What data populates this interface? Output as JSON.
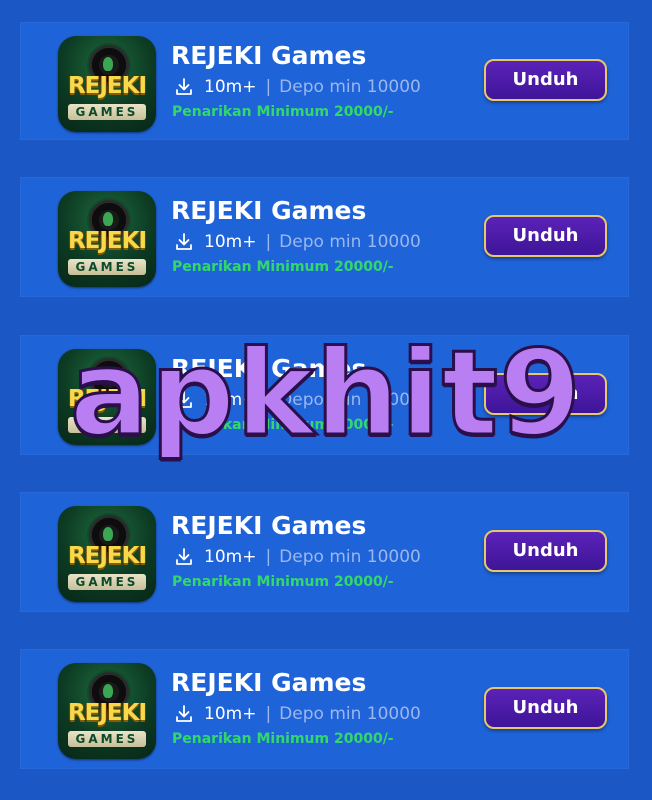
{
  "colors": {
    "background": "#1b58c6",
    "card": "#1f63d9",
    "button": "#4a1aa8",
    "button_border": "#e8c66b",
    "withdraw_text": "#32d96a",
    "meta_text": "#9bb7ee",
    "watermark": "#b97ef2"
  },
  "icon_text": {
    "top": "REJEKI",
    "bottom": "GAMES"
  },
  "apps": [
    {
      "name": "REJEKI Games",
      "downloads": "10m+",
      "separator": "|",
      "deposit": "Depo min 10000",
      "withdraw": "Penarikan Minimum 20000/-",
      "button": "Unduh",
      "download_icon": "download-icon"
    },
    {
      "name": "REJEKI Games",
      "downloads": "10m+",
      "separator": "|",
      "deposit": "Depo min 10000",
      "withdraw": "Penarikan Minimum 20000/-",
      "button": "Unduh",
      "download_icon": "download-icon"
    },
    {
      "name": "REJEKI Games",
      "downloads": "10m+",
      "separator": "|",
      "deposit": "Depo min 10000",
      "withdraw": "Penarikan Minimum 20000/-",
      "button": "Unduh",
      "download_icon": "download-icon"
    },
    {
      "name": "REJEKI Games",
      "downloads": "10m+",
      "separator": "|",
      "deposit": "Depo min 10000",
      "withdraw": "Penarikan Minimum 20000/-",
      "button": "Unduh",
      "download_icon": "download-icon"
    },
    {
      "name": "REJEKI Games",
      "downloads": "10m+",
      "separator": "|",
      "deposit": "Depo min 10000",
      "withdraw": "Penarikan Minimum 20000/-",
      "button": "Unduh",
      "download_icon": "download-icon"
    }
  ],
  "watermark": "apkhit9"
}
